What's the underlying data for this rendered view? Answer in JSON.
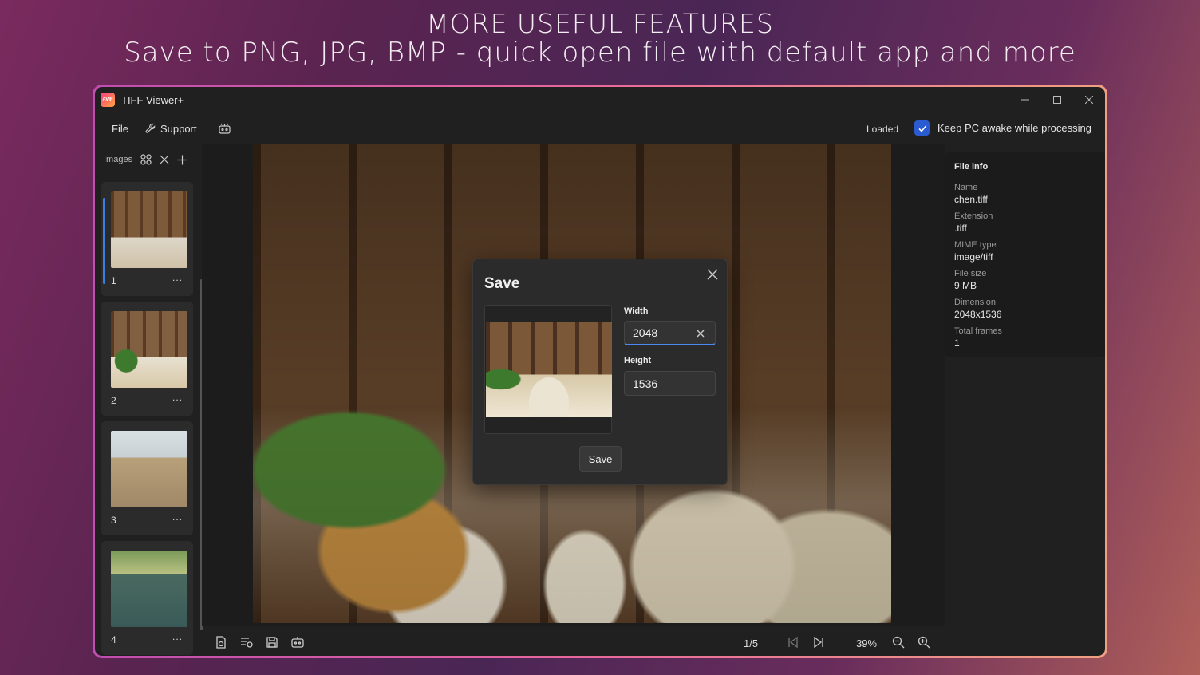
{
  "headline": {
    "line1": "MORE USEFUL FEATURES",
    "line2": "Save to PNG, JPG, BMP - quick open file with default app and more"
  },
  "window": {
    "title": "TIFF Viewer+",
    "logo_text": "AVIF",
    "controls": [
      "minimize-icon",
      "maximize-icon",
      "close-icon"
    ]
  },
  "menu": {
    "file": "File",
    "support": "Support",
    "status": "Loaded",
    "keep_awake_label": "Keep PC awake while processing",
    "keep_awake_checked": true
  },
  "sidebar": {
    "title": "Images",
    "thumbnails": [
      {
        "number": "1",
        "more": "...",
        "active": true
      },
      {
        "number": "2",
        "more": "...",
        "active": false
      },
      {
        "number": "3",
        "more": "...",
        "active": false
      },
      {
        "number": "4",
        "more": "...",
        "active": false
      }
    ]
  },
  "bottombar": {
    "page": "1/5",
    "zoom": "39%"
  },
  "file_info": {
    "title": "File info",
    "fields": [
      {
        "label": "Name",
        "value": "chen.tiff"
      },
      {
        "label": "Extension",
        "value": ".tiff"
      },
      {
        "label": "MIME type",
        "value": "image/tiff"
      },
      {
        "label": "File size",
        "value": "9 MB"
      },
      {
        "label": "Dimension",
        "value": "2048x1536"
      },
      {
        "label": "Total frames",
        "value": "1"
      }
    ]
  },
  "save_dialog": {
    "title": "Save",
    "width_label": "Width",
    "width_value": "2048",
    "height_label": "Height",
    "height_value": "1536",
    "save_button": "Save"
  },
  "colors": {
    "accent": "#2a5bd0",
    "window_bg": "#202020",
    "frame_gradient_start": "#c04db0",
    "frame_gradient_end": "#f0a080"
  }
}
